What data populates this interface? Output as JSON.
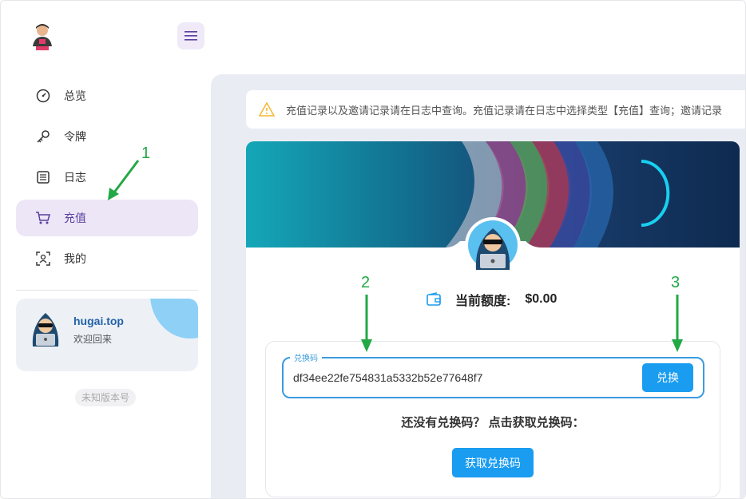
{
  "sidebar": {
    "items": [
      {
        "label": "总览",
        "icon": "dashboard-icon"
      },
      {
        "label": "令牌",
        "icon": "key-icon"
      },
      {
        "label": "日志",
        "icon": "log-icon"
      },
      {
        "label": "充值",
        "icon": "cart-icon",
        "active": true
      },
      {
        "label": "我的",
        "icon": "profile-scan-icon"
      }
    ],
    "user": {
      "name": "hugai.top",
      "subtitle": "欢迎回来"
    },
    "version": "未知版本号"
  },
  "notice": {
    "text": "充值记录以及邀请记录请在日志中查询。充值记录请在日志中选择类型【充值】查询；邀请记录"
  },
  "balance": {
    "label": "当前额度:",
    "value": "$0.00"
  },
  "redeem": {
    "field_label": "兑换码",
    "code": "df34ee22fe754831a5332b52e77648f7",
    "redeem_button": "兑换",
    "prompt": "还没有兑换码？ 点击获取兑换码：",
    "get_button": "获取兑换码"
  },
  "annotations": [
    {
      "number": "1"
    },
    {
      "number": "2"
    },
    {
      "number": "3"
    }
  ],
  "colors": {
    "accent": "#1a9cf0",
    "active_bg": "#ece6f6",
    "annotation": "#22a845"
  }
}
